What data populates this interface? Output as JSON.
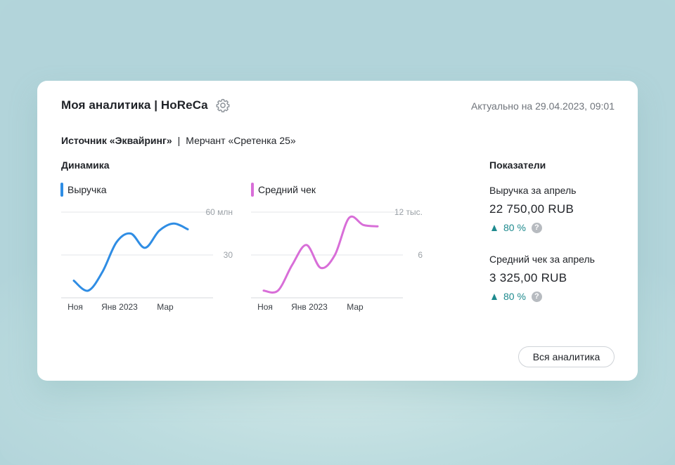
{
  "header": {
    "title": "Моя аналитика | HoReCa",
    "settings_icon": "gear-icon",
    "updated": "Актуально на 29.04.2023, 09:01"
  },
  "filters": {
    "source": "Источник «Эквайринг»",
    "separator": "|",
    "merchant": "Мерчант «Сретенка 25»"
  },
  "dynamics": {
    "title": "Динамика"
  },
  "charts": {
    "revenue": {
      "legend": "Выручка",
      "color": "#2f8de4"
    },
    "avg_check": {
      "legend": "Средний чек",
      "color": "#d86ed8"
    }
  },
  "chart_data": [
    {
      "type": "line",
      "series": [
        {
          "name": "Выручка",
          "values": [
            12,
            5,
            18,
            39,
            45,
            35,
            47,
            52,
            48
          ]
        }
      ],
      "x": [
        "Ноя",
        "",
        "",
        "Янв 2023",
        "",
        "",
        "Мар",
        "",
        ""
      ],
      "xticks": [
        "Ноя",
        "Янв 2023",
        "Мар"
      ],
      "yticks": [
        "30",
        "60 млн"
      ],
      "ylim": [
        0,
        60
      ],
      "grid": true
    },
    {
      "type": "line",
      "series": [
        {
          "name": "Средний чек",
          "values": [
            1,
            1,
            4.6,
            7.4,
            4.2,
            6,
            11.2,
            10.2,
            10.0
          ]
        }
      ],
      "x": [
        "Ноя",
        "",
        "",
        "Янв 2023",
        "",
        "",
        "Мар",
        "",
        ""
      ],
      "xticks": [
        "Ноя",
        "Янв 2023",
        "Мар"
      ],
      "yticks": [
        "6",
        "12 тыс."
      ],
      "ylim": [
        0,
        12
      ],
      "grid": true
    }
  ],
  "indicators": {
    "title": "Показатели",
    "items": [
      {
        "label": "Выручка за апрель",
        "value": "22 750,00 RUB",
        "change": "80 %",
        "help": "?"
      },
      {
        "label": "Средний чек за апрель",
        "value": "3 325,00 RUB",
        "change": "80 %",
        "help": "?"
      }
    ]
  },
  "actions": {
    "all_analytics": "Вся аналитика"
  }
}
